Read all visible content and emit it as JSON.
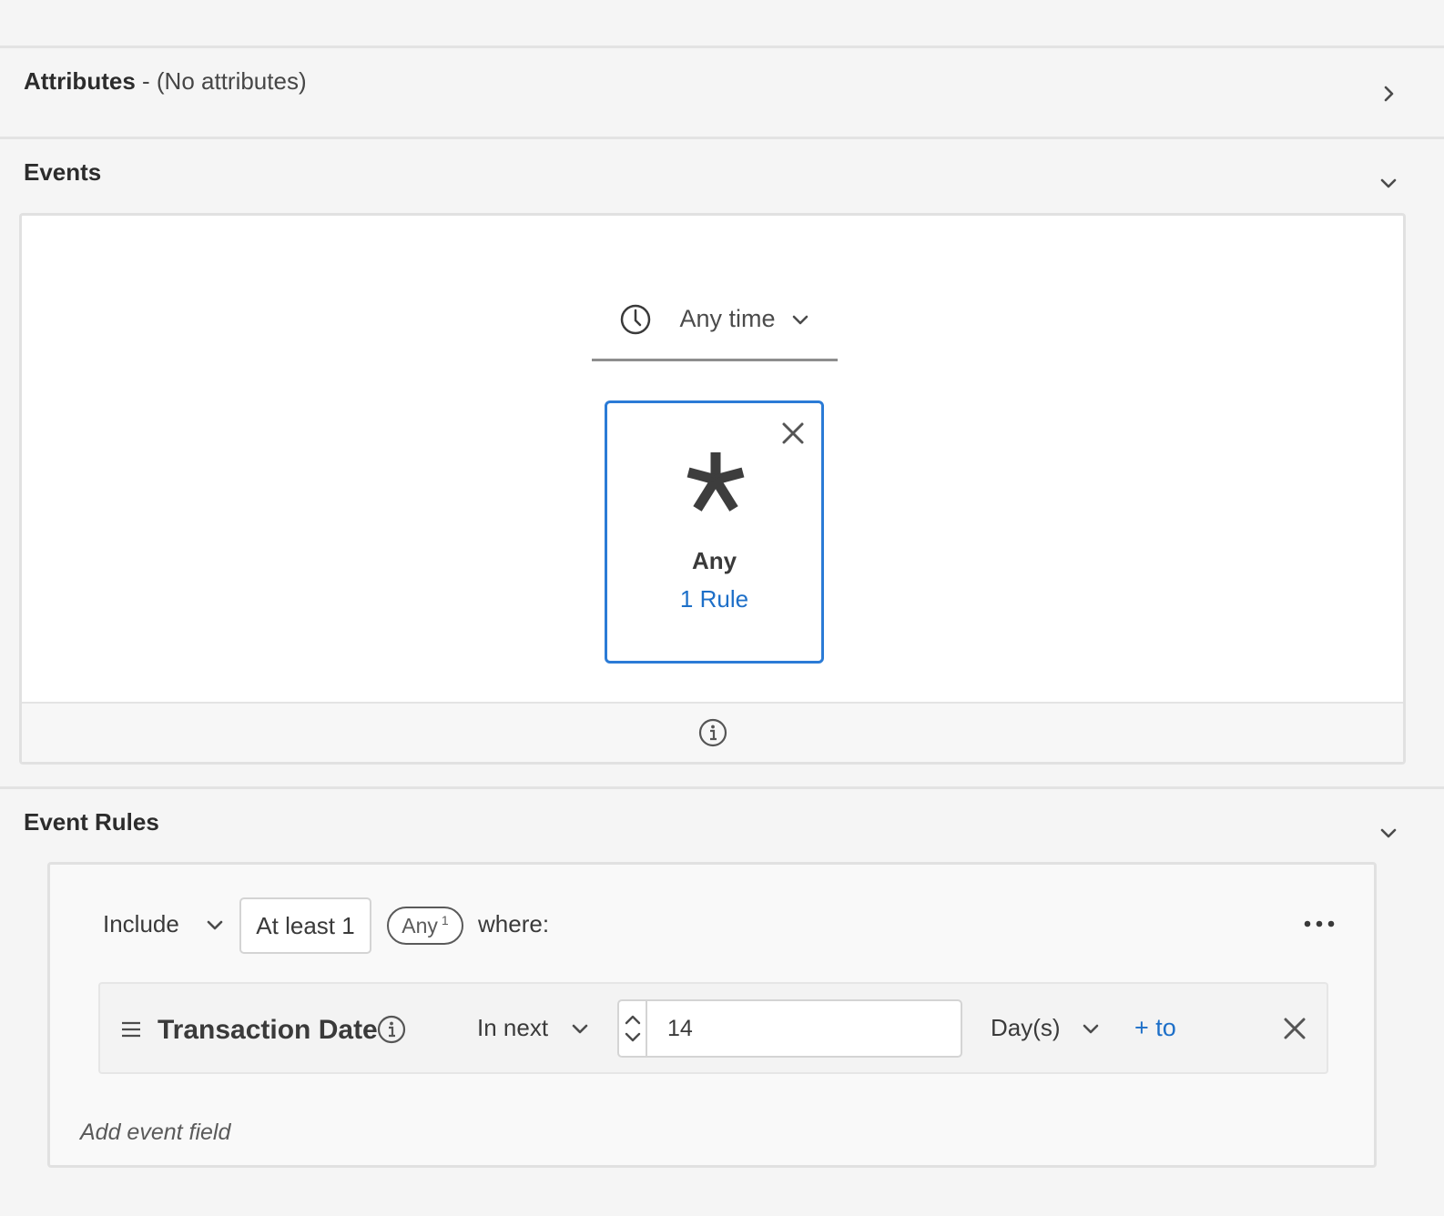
{
  "attributes": {
    "title": "Attributes",
    "subtitle": " - (No attributes)"
  },
  "events": {
    "title": "Events",
    "time_filter": "Any time",
    "card": {
      "name": "Any",
      "rules_link": "1 Rule"
    }
  },
  "event_rules": {
    "title": "Event Rules",
    "include_label": "Include",
    "count_value": "At least 1",
    "event_pill": "Any",
    "event_pill_count": "1",
    "where_label": "where:",
    "field": {
      "name": "Transaction Date",
      "operator": "In next",
      "value": "14",
      "unit": "Day(s)",
      "add_range": "+ to"
    },
    "add_field": "Add event field"
  },
  "icons": {
    "attributes_toggle": "chevron-right-icon",
    "events_toggle": "chevron-down-icon",
    "rules_toggle": "chevron-down-icon",
    "time": "clock-icon",
    "card_remove": "close-icon",
    "card_symbol": "asterisk-icon",
    "footer_info": "info-icon",
    "more": "more-horizontal-icon",
    "drag": "drag-handle-icon",
    "field_info": "info-icon",
    "field_remove": "close-icon"
  },
  "colors": {
    "accent": "#1d6fc8",
    "selected_border": "#2b7bd6",
    "background": "#f5f5f5"
  }
}
